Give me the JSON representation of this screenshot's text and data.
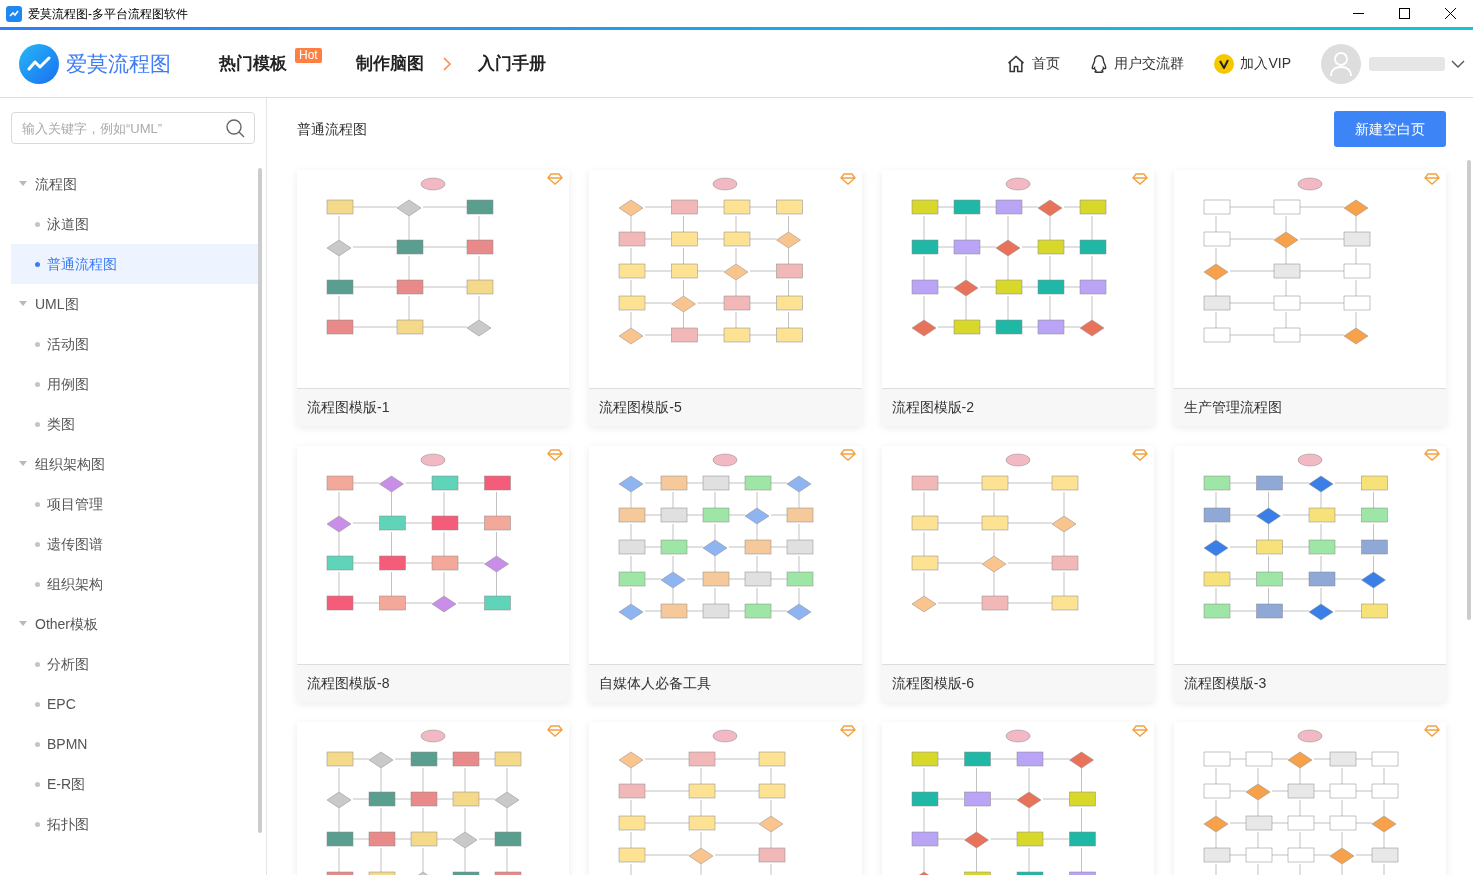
{
  "window": {
    "title": "爱莫流程图-多平台流程图软件"
  },
  "header": {
    "logo": "爱莫流程图",
    "nav": [
      {
        "label": "热门模板",
        "badge": "Hot"
      },
      {
        "label": "制作脑图",
        "chevron": true
      },
      {
        "label": "入门手册"
      }
    ],
    "links": [
      {
        "label": "首页",
        "kind": "home"
      },
      {
        "label": "用户交流群",
        "kind": "qq"
      },
      {
        "label": "加入VIP",
        "kind": "vip"
      }
    ]
  },
  "sidebar": {
    "search": {
      "placeholder": "输入关键字，例如“UML”"
    },
    "tree": [
      {
        "label": "流程图",
        "expanded": true,
        "children": [
          {
            "label": "泳道图",
            "selected": false
          },
          {
            "label": "普通流程图",
            "selected": true
          }
        ]
      },
      {
        "label": "UML图",
        "expanded": true,
        "children": [
          {
            "label": "活动图",
            "selected": false
          },
          {
            "label": "用例图",
            "selected": false
          },
          {
            "label": "类图",
            "selected": false
          }
        ]
      },
      {
        "label": "组织架构图",
        "expanded": true,
        "children": [
          {
            "label": "项目管理",
            "selected": false
          },
          {
            "label": "遗传图谱",
            "selected": false
          },
          {
            "label": "组织架构",
            "selected": false
          }
        ]
      },
      {
        "label": "Other模板",
        "expanded": true,
        "children": [
          {
            "label": "分析图",
            "selected": false
          },
          {
            "label": "EPC",
            "selected": false
          },
          {
            "label": "BPMN",
            "selected": false
          },
          {
            "label": "E-R图",
            "selected": false
          },
          {
            "label": "拓扑图",
            "selected": false
          }
        ]
      }
    ]
  },
  "content": {
    "title": "普通流程图",
    "new_button": "新建空白页",
    "templates": [
      {
        "name": "流程图模版-1",
        "premium": true
      },
      {
        "name": "流程图模版-5",
        "premium": true
      },
      {
        "name": "流程图模版-2",
        "premium": true
      },
      {
        "name": "生产管理流程图",
        "premium": true
      },
      {
        "name": "流程图模版-8",
        "premium": true
      },
      {
        "name": "自媒体人必备工具",
        "premium": true
      },
      {
        "name": "流程图模版-6",
        "premium": true
      },
      {
        "name": "流程图模版-3",
        "premium": true
      },
      {
        "premium": true
      },
      {
        "premium": true
      },
      {
        "premium": true
      },
      {
        "premium": true
      }
    ]
  }
}
